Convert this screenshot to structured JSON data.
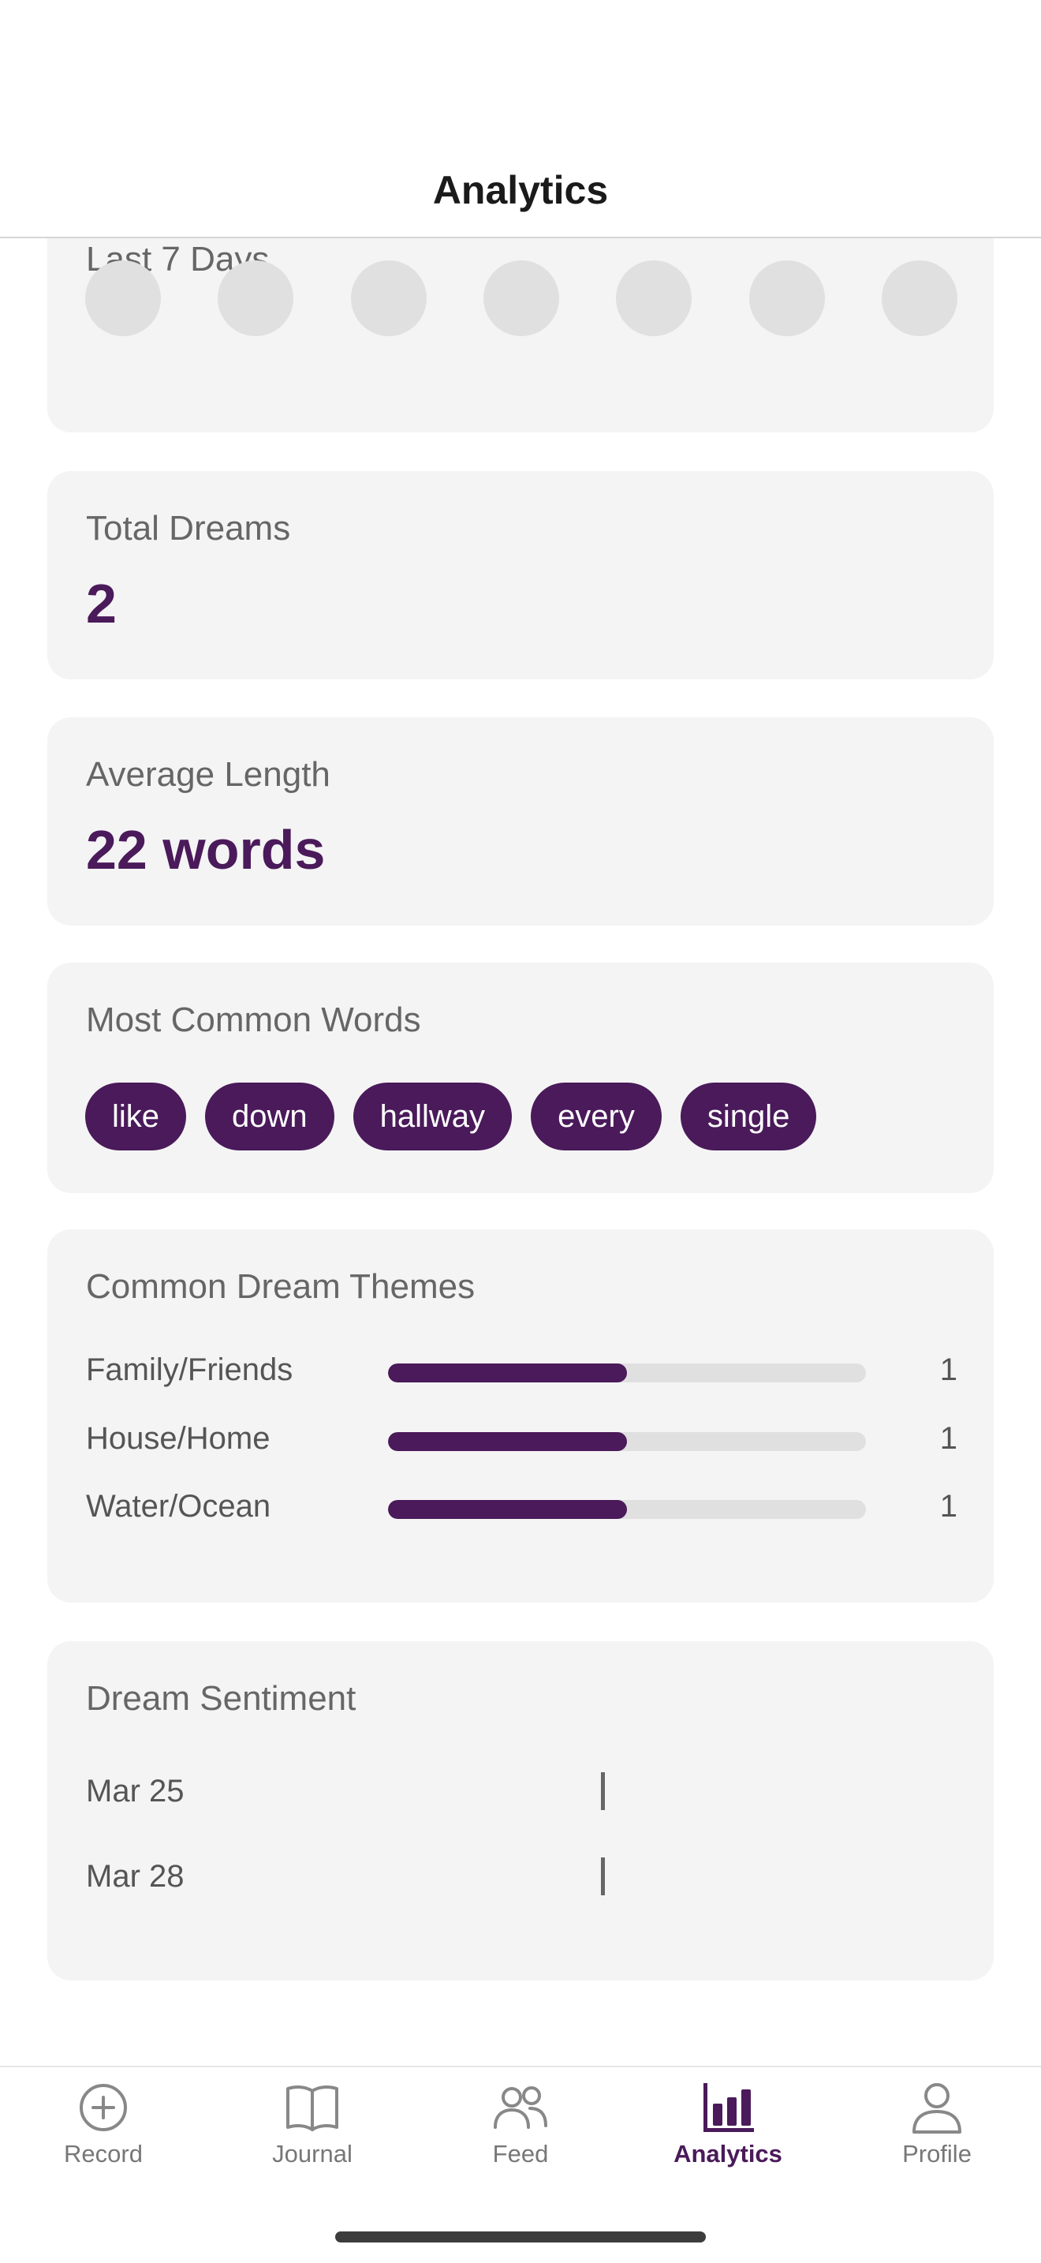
{
  "header": {
    "title": "Analytics"
  },
  "last7": {
    "label": "Last 7 Days",
    "days": [
      0,
      0,
      0,
      0,
      0,
      0,
      0
    ]
  },
  "total": {
    "label": "Total Dreams",
    "value": "2"
  },
  "avg": {
    "label": "Average Length",
    "value": "22 words"
  },
  "words": {
    "label": "Most Common Words",
    "items": [
      "like",
      "down",
      "hallway",
      "every",
      "single"
    ]
  },
  "themes": {
    "label": "Common Dream Themes",
    "items": [
      {
        "name": "Family/Friends",
        "count": "1",
        "fraction": 0.5
      },
      {
        "name": "House/Home",
        "count": "1",
        "fraction": 0.5
      },
      {
        "name": "Water/Ocean",
        "count": "1",
        "fraction": 0.5
      }
    ]
  },
  "sentiment": {
    "label": "Dream Sentiment",
    "items": [
      {
        "date": "Mar 25"
      },
      {
        "date": "Mar 28"
      }
    ]
  },
  "tabs": [
    {
      "label": "Record",
      "icon": "plus-circle-icon"
    },
    {
      "label": "Journal",
      "icon": "book-icon"
    },
    {
      "label": "Feed",
      "icon": "people-icon"
    },
    {
      "label": "Analytics",
      "icon": "bar-chart-icon",
      "active": true
    },
    {
      "label": "Profile",
      "icon": "person-icon"
    }
  ],
  "colors": {
    "accent": "#4a1a5a",
    "card": "#f4f4f4",
    "track": "#e0e0e0"
  }
}
